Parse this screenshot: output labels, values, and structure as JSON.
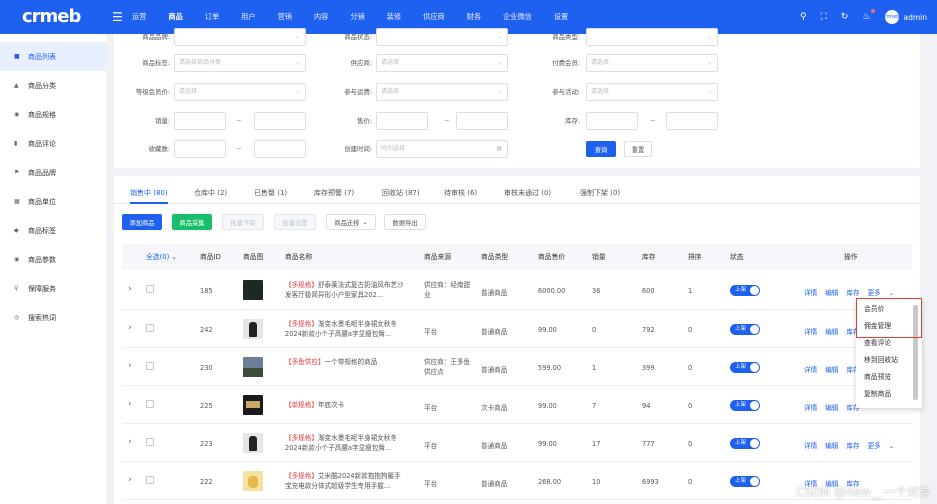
{
  "app": {
    "logo": "crmeb"
  },
  "topnav": [
    "运营",
    "商品",
    "订单",
    "用户",
    "营销",
    "内容",
    "分销",
    "装修",
    "供应商",
    "财务",
    "企业微信",
    "设置"
  ],
  "user": {
    "name": "admin",
    "avatar_text": "crmeb"
  },
  "sidebar": [
    "商品列表",
    "商品分类",
    "商品规格",
    "商品评论",
    "商品品牌",
    "商品单位",
    "商品标签",
    "商品参数",
    "保障服务",
    "搜索热词"
  ],
  "filter": {
    "row0": {
      "label1": "商品品牌:",
      "label2": "商品状态:",
      "label3": "商品类型:"
    },
    "row1": {
      "label1": "商品标签:",
      "ph1": "请选择商品分类",
      "label2": "供应商:",
      "ph2": "请选择",
      "label3": "付费会员:",
      "ph3": "请选择"
    },
    "row2": {
      "label1": "等级会员价:",
      "ph1": "请选择",
      "label2": "参与运费:",
      "ph2": "请选择",
      "label3": "参与活动:",
      "ph3": "请选择"
    },
    "row3": {
      "label1": "销量:",
      "label2": "售价:",
      "label3": "库存:",
      "dash": "~"
    },
    "row4": {
      "label1": "收藏数:",
      "label2": "创建时间:",
      "ph2": "时间选择"
    },
    "search_btn": "查询",
    "reset_btn": "重置"
  },
  "tabs": [
    "销售中 (80)",
    "仓库中 (2)",
    "已售罄 (1)",
    "库存预警 (7)",
    "回收站 (87)",
    "待审核 (6)",
    "审核未通过 (0)",
    "强制下架 (0)"
  ],
  "actions": {
    "add": "添加商品",
    "collect": "商品采集",
    "batch_off": "批量下架",
    "batch_set": "批量设置",
    "move": "商品迁移",
    "export": "数据导出"
  },
  "table": {
    "headers": {
      "select_all": "全选(0)",
      "id": "商品ID",
      "image": "商品图",
      "name": "商品名称",
      "source": "商品来源",
      "type": "商品类型",
      "price": "商品售价",
      "sales": "销量",
      "stock": "库存",
      "sort": "排序",
      "status": "状态",
      "ops": "操作"
    },
    "rows": [
      {
        "id": "185",
        "tag": "【多规格】",
        "name": "舒泰莱法式复古奶油风布艺沙发客厅极简异形小户型家具202...",
        "source": "供应商：经南甜业",
        "type": "普通商品",
        "price": "6000.00",
        "sales": "36",
        "stock": "600",
        "sort": "1",
        "status": "上架"
      },
      {
        "id": "242",
        "tag": "【多规格】",
        "name": "渐变水墨毛呢半身裙女秋冬2024新款小个子高腰a字显瘦包臀...",
        "source": "平台",
        "type": "普通商品",
        "price": "99.00",
        "sales": "0",
        "stock": "792",
        "sort": "0",
        "status": "上架"
      },
      {
        "id": "230",
        "tag": "【多鱼供应】",
        "name": "一个带规格的商品",
        "source": "供应商：王多鱼供应点",
        "type": "普通商品",
        "price": "599.00",
        "sales": "1",
        "stock": "399",
        "sort": "0",
        "status": "上架"
      },
      {
        "id": "225",
        "tag": "【单规格】",
        "name": "年底次卡",
        "source": "平台",
        "type": "次卡商品",
        "price": "99.00",
        "sales": "7",
        "stock": "94",
        "sort": "0",
        "status": "上架"
      },
      {
        "id": "223",
        "tag": "【多规格】",
        "name": "渐变水墨毛呢半身裙女秋冬2024新款小个子高腰a字显瘦包臀...",
        "source": "平台",
        "type": "普通商品",
        "price": "99.00",
        "sales": "17",
        "stock": "777",
        "sort": "0",
        "status": "上架"
      },
      {
        "id": "222",
        "tag": "【多规格】",
        "name": "艾米酷2024新款抱抱狗暖手宝充电款分体式超级学生专用手握...",
        "source": "平台",
        "type": "普通商品",
        "price": "268.00",
        "sales": "10",
        "stock": "6993",
        "sort": "0",
        "status": "上架"
      }
    ],
    "ops": {
      "detail": "详情",
      "edit": "编辑",
      "stock": "库存",
      "more": "更多"
    }
  },
  "more_menu": [
    "会员价",
    "佣金管理",
    "查看评论",
    "移到回收站",
    "商品预览",
    "复制商品"
  ],
  "watermark": "CSDN @new__一个对象",
  "colors": {
    "primary": "#1e60f0",
    "green": "#19be6b",
    "red_tag": "#e4393c",
    "highlight": "#e0403c"
  }
}
